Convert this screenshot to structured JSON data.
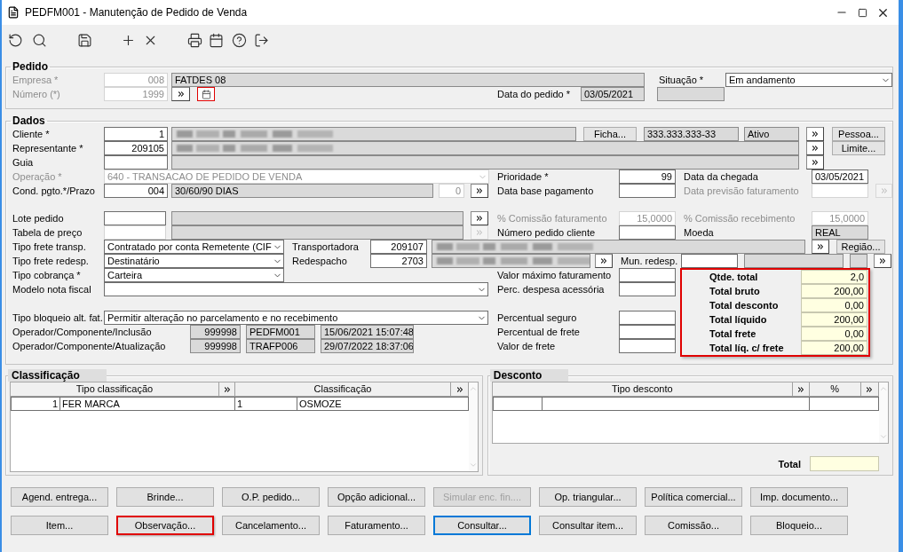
{
  "window": {
    "title": "PEDFM001 - Manutenção de Pedido de Venda"
  },
  "pedido": {
    "legend": "Pedido",
    "rows": [
      {
        "items": [
          {
            "kind": "label",
            "text": "Empresa *",
            "disabled": true
          },
          {
            "kind": "disabled",
            "value": "008"
          },
          {
            "kind": "readonly",
            "value": "FATDES 08"
          },
          {
            "kind": "label",
            "text": "Situação *",
            "disabled": false
          },
          {
            "kind": "select",
            "value": "Em andamento",
            "disabled": false
          }
        ]
      },
      {
        "items": [
          {
            "kind": "label",
            "text": "Número (*)",
            "disabled": true
          },
          {
            "kind": "disabled",
            "value": "1999"
          },
          {
            "kind": "jump",
            "disabled": false
          },
          {
            "kind": "calendar",
            "highlighted": true
          },
          {
            "kind": "label",
            "text": "Data do pedido *",
            "disabled": false
          },
          {
            "kind": "readonly",
            "value": "03/05/2021"
          },
          {
            "kind": "readonly"
          }
        ]
      }
    ]
  },
  "dados": {
    "legend": "Dados",
    "rows": [
      {
        "items": [
          {
            "kind": "label",
            "text": "Cliente *",
            "disabled": false
          },
          {
            "kind": "input",
            "value": "1"
          },
          {
            "kind": "blurred"
          },
          {
            "kind": "button",
            "label": "Ficha...",
            "disabled": false
          },
          {
            "kind": "readonly",
            "value": "333.333.333-33"
          },
          {
            "kind": "readonly",
            "value": "Ativo"
          },
          {
            "kind": "jump",
            "disabled": false
          },
          {
            "kind": "button",
            "label": "Pessoa...",
            "disabled": false
          }
        ]
      },
      {
        "items": [
          {
            "kind": "label",
            "text": "Representante *",
            "disabled": false
          },
          {
            "kind": "input",
            "value": "209105"
          },
          {
            "kind": "blurred"
          },
          {
            "kind": "jump",
            "disabled": false
          },
          {
            "kind": "button",
            "label": "Limite...",
            "disabled": false
          }
        ]
      },
      {
        "items": [
          {
            "kind": "label",
            "text": "Guia",
            "disabled": false
          },
          {
            "kind": "input"
          },
          {
            "kind": "readonly"
          },
          {
            "kind": "jump",
            "disabled": false
          }
        ]
      },
      {
        "items": [
          {
            "kind": "label",
            "text": "Operação *",
            "disabled": true
          },
          {
            "kind": "select",
            "value": "640 - TRANSACAO DE PEDIDO DE VENDA",
            "disabled": true
          },
          {
            "kind": "label",
            "text": "Prioridade *",
            "disabled": false
          },
          {
            "kind": "input",
            "value": "99"
          },
          {
            "kind": "label",
            "text": "Data da chegada",
            "disabled": false
          },
          {
            "kind": "input",
            "value": "03/05/2021"
          }
        ]
      },
      {
        "items": [
          {
            "kind": "label",
            "text": "Cond. pgto.*/Prazo",
            "disabled": false
          },
          {
            "kind": "input",
            "value": "004"
          },
          {
            "kind": "readonly",
            "value": "30/60/90 DIAS"
          },
          {
            "kind": "disabled",
            "value": "0"
          },
          {
            "kind": "jump",
            "disabled": false
          },
          {
            "kind": "label",
            "text": "Data base pagamento",
            "disabled": false
          },
          {
            "kind": "input"
          },
          {
            "kind": "label",
            "text": "Data previsão faturamento",
            "disabled": true
          },
          {
            "kind": "disabled"
          },
          {
            "kind": "jump",
            "disabled": true
          }
        ]
      },
      {
        "items": [
          {
            "kind": "label",
            "text": "Lote pedido",
            "disabled": false
          },
          {
            "kind": "input"
          },
          {
            "kind": "readonly"
          },
          {
            "kind": "jump",
            "disabled": false
          },
          {
            "kind": "label",
            "text": "% Comissão faturamento",
            "disabled": true
          },
          {
            "kind": "disabled",
            "value": "15,0000"
          },
          {
            "kind": "label",
            "text": "% Comissão recebimento",
            "disabled": true
          },
          {
            "kind": "disabled",
            "value": "15,0000"
          }
        ]
      },
      {
        "items": [
          {
            "kind": "label",
            "text": "Tabela de preço",
            "disabled": false
          },
          {
            "kind": "disabled"
          },
          {
            "kind": "readonly"
          },
          {
            "kind": "jump",
            "disabled": true
          },
          {
            "kind": "label",
            "text": "Número pedido cliente",
            "disabled": false
          },
          {
            "kind": "input"
          },
          {
            "kind": "label",
            "text": "Moeda",
            "disabled": false
          },
          {
            "kind": "readonly",
            "value": "REAL"
          }
        ]
      },
      {
        "items": [
          {
            "kind": "label",
            "text": "Tipo frete transp.",
            "disabled": false
          },
          {
            "kind": "select",
            "value": "Contratado por conta Remetente (CIF",
            "disabled": false
          },
          {
            "kind": "label",
            "text": "Transportadora",
            "disabled": false
          },
          {
            "kind": "input",
            "value": "209107"
          },
          {
            "kind": "blurred"
          },
          {
            "kind": "jump",
            "disabled": false
          },
          {
            "kind": "button",
            "label": "Região...",
            "disabled": false
          }
        ]
      },
      {
        "items": [
          {
            "kind": "label",
            "text": "Tipo frete redesp.",
            "disabled": false
          },
          {
            "kind": "select",
            "value": "Destinatário",
            "disabled": false
          },
          {
            "kind": "label",
            "text": "Redespacho",
            "disabled": false
          },
          {
            "kind": "input",
            "value": "2703"
          },
          {
            "kind": "blurred"
          },
          {
            "kind": "jump",
            "disabled": false
          },
          {
            "kind": "label",
            "text": "Mun. redesp.",
            "disabled": false
          },
          {
            "kind": "input"
          },
          {
            "kind": "readonly"
          },
          {
            "kind": "readonly"
          },
          {
            "kind": "jump",
            "disabled": false
          }
        ]
      }
    ],
    "lower_rows": [
      {
        "items": [
          {
            "kind": "label",
            "text": "Tipo cobrança *",
            "disabled": false
          },
          {
            "kind": "select",
            "value": "Carteira",
            "disabled": false
          },
          {
            "kind": "label",
            "text": "Valor máximo faturamento",
            "disabled": false
          },
          {
            "kind": "input"
          }
        ]
      },
      {
        "items": [
          {
            "kind": "label",
            "text": "Modelo nota fiscal",
            "disabled": false
          },
          {
            "kind": "select",
            "disabled": false
          },
          {
            "kind": "label",
            "text": "Perc. despesa acessória",
            "disabled": false
          },
          {
            "kind": "input"
          }
        ]
      },
      {
        "items": [
          {
            "kind": "label",
            "text": "Tipo bloqueio alt. fat.",
            "disabled": false
          },
          {
            "kind": "select",
            "value": "Permitir alteração no parcelamento e no recebimento",
            "disabled": false
          },
          {
            "kind": "label",
            "text": "Percentual seguro",
            "disabled": false
          },
          {
            "kind": "input"
          }
        ]
      },
      {
        "items": [
          {
            "kind": "label",
            "text": "Operador/Componente/Inclusão",
            "disabled": false
          },
          {
            "kind": "readonly",
            "value": "999998"
          },
          {
            "kind": "readonly",
            "value": "PEDFM001"
          },
          {
            "kind": "readonly",
            "value": "15/06/2021 15:07:48"
          },
          {
            "kind": "label",
            "text": "Percentual de frete",
            "disabled": false
          },
          {
            "kind": "input"
          }
        ]
      },
      {
        "items": [
          {
            "kind": "label",
            "text": "Operador/Componente/Atualização",
            "disabled": false
          },
          {
            "kind": "readonly",
            "value": "999998"
          },
          {
            "kind": "readonly",
            "value": "TRAFP006"
          },
          {
            "kind": "readonly",
            "value": "29/07/2022 18:37:06"
          },
          {
            "kind": "label",
            "text": "Valor de frete",
            "disabled": false
          },
          {
            "kind": "input"
          }
        ]
      }
    ],
    "totals": {
      "highlighted": true,
      "rows": [
        {
          "label": "Qtde. total",
          "value": "2,0"
        },
        {
          "label": "Total bruto",
          "value": "200,00"
        },
        {
          "label": "Total desconto",
          "value": "0,00"
        },
        {
          "label": "Total líquido",
          "value": "200,00"
        },
        {
          "label": "Total frete",
          "value": "0,00"
        },
        {
          "label": "Total líq. c/ frete",
          "value": "200,00"
        }
      ]
    }
  },
  "classificacao": {
    "legend": "Classificação",
    "columns": [
      {
        "label": "Tipo classificação"
      },
      {
        "label": "Classificação"
      }
    ],
    "rows": [
      {
        "tipo_classificacao": {
          "code": "1",
          "description": "FER MARCA"
        },
        "classificacao": {
          "code": "1",
          "description": "OSMOZE"
        }
      }
    ]
  },
  "desconto": {
    "legend": "Desconto",
    "columns": [
      {
        "label": "Tipo desconto"
      },
      {
        "label": "%"
      }
    ],
    "total_label": "Total"
  },
  "button_rows": [
    {
      "buttons": [
        {
          "label": "Agend. entrega...",
          "disabled": false,
          "focused": false,
          "highlighted": false
        },
        {
          "label": "Brinde...",
          "disabled": false,
          "focused": false,
          "highlighted": false
        },
        {
          "label": "O.P. pedido...",
          "disabled": false,
          "focused": false,
          "highlighted": false
        },
        {
          "label": "Opção adicional...",
          "disabled": false,
          "focused": false,
          "highlighted": false
        },
        {
          "label": "Simular enc. fin....",
          "disabled": true,
          "focused": false,
          "highlighted": false
        },
        {
          "label": "Op. triangular...",
          "disabled": false,
          "focused": false,
          "highlighted": false
        },
        {
          "label": "Política comercial...",
          "disabled": false,
          "focused": false,
          "highlighted": false
        },
        {
          "label": "Imp. documento...",
          "disabled": false,
          "focused": false,
          "highlighted": false
        }
      ]
    },
    {
      "buttons": [
        {
          "label": "Item...",
          "disabled": false,
          "focused": false,
          "highlighted": false
        },
        {
          "label": "Observação...",
          "disabled": false,
          "focused": false,
          "highlighted": true
        },
        {
          "label": "Cancelamento...",
          "disabled": false,
          "focused": false,
          "highlighted": false
        },
        {
          "label": "Faturamento...",
          "disabled": false,
          "focused": false,
          "highlighted": false
        },
        {
          "label": "Consultar...",
          "disabled": false,
          "focused": true,
          "highlighted": false
        },
        {
          "label": "Consultar item...",
          "disabled": false,
          "focused": false,
          "highlighted": false
        },
        {
          "label": "Comissão...",
          "disabled": false,
          "focused": false,
          "highlighted": false
        },
        {
          "label": "Bloqueio...",
          "disabled": false,
          "focused": false,
          "highlighted": false
        }
      ]
    }
  ]
}
